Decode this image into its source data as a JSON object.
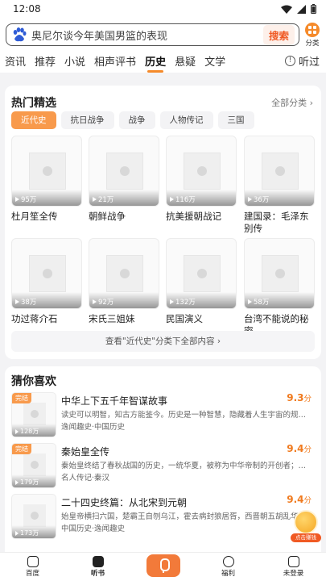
{
  "status": {
    "time": "12:08"
  },
  "search": {
    "query": "奥尼尔谈今年美国男篮的表现",
    "button": "搜索",
    "category_label": "分类"
  },
  "tabs": [
    "资讯",
    "推荐",
    "小说",
    "相声评书",
    "历史",
    "悬疑",
    "文学"
  ],
  "active_tab": 4,
  "listen_label": "听过",
  "hot": {
    "title": "热门精选",
    "all_label": "全部分类",
    "chips": [
      "近代史",
      "抗日战争",
      "战争",
      "人物传记",
      "三国"
    ],
    "items": [
      {
        "title": "杜月笙全传",
        "plays": "95万"
      },
      {
        "title": "朝鲜战争",
        "plays": "21万"
      },
      {
        "title": "抗美援朝战记",
        "plays": "116万"
      },
      {
        "title": "建国录：毛泽东别传",
        "plays": "36万"
      },
      {
        "title": "功过蒋介石",
        "plays": "38万"
      },
      {
        "title": "宋氏三姐妹",
        "plays": "92万"
      },
      {
        "title": "民国演义",
        "plays": "132万"
      },
      {
        "title": "台湾不能说的秘密",
        "plays": "58万"
      }
    ],
    "more_label": "查看\"近代史\"分类下全部内容"
  },
  "guess": {
    "title": "猜你喜欢",
    "items": [
      {
        "title": "中华上下五千年智谋故事",
        "score": "9.3",
        "unit": "分",
        "desc": "读史可以明智，知古方能鉴今。历史是一种智慧，隐藏着人生宇宙的规则…",
        "tags": "逸闻趣史·中国历史",
        "plays": "128万",
        "badge": "完结"
      },
      {
        "title": "秦始皇全传",
        "score": "9.4",
        "unit": "分",
        "desc": "秦始皇终结了春秋战国的历史，一统华夏，被称为中华帝制的开创者；他…",
        "tags": "名人传记·秦汉",
        "plays": "179万",
        "badge": "完结"
      },
      {
        "title": "二十四史终篇：从北宋到元朝",
        "score": "9.4",
        "unit": "分",
        "desc": "始皇帝横扫六国，楚霸王自刎乌江，霍去病封狼居胥，西晋朝五胡乱华，…",
        "tags": "中国历史·逸闻趣史",
        "plays": "173万",
        "badge": ""
      }
    ]
  },
  "float_label": "点击赚钱",
  "bottom_nav": [
    "百度",
    "听书",
    "",
    "福利",
    "未登录"
  ]
}
